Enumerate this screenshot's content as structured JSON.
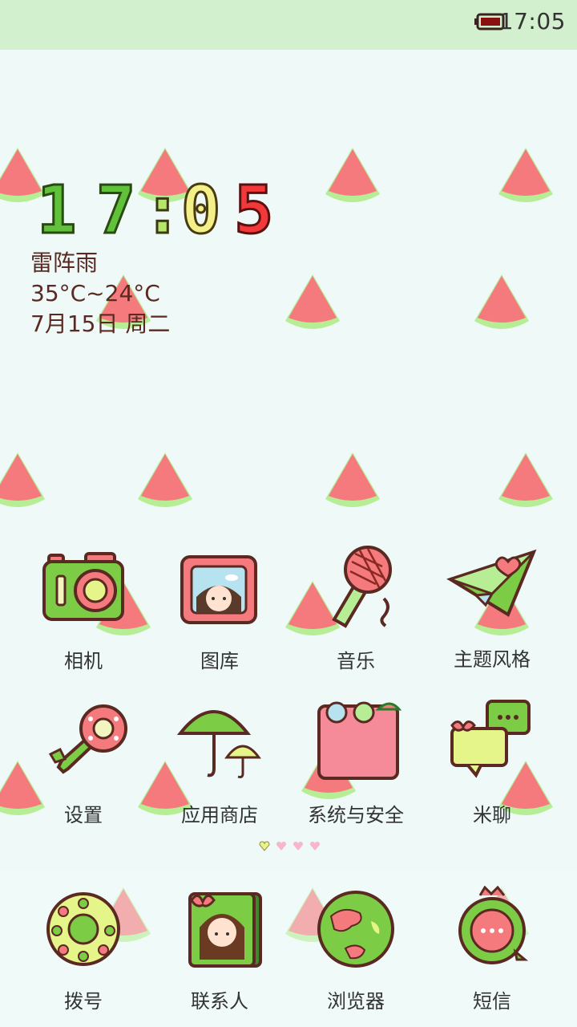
{
  "status_bar": {
    "time": "17:05",
    "battery_icon": "battery-icon"
  },
  "clock_widget": {
    "h1": "1",
    "h2": "7",
    "sep": ":",
    "m1": "0",
    "m2": "5"
  },
  "weather": {
    "condition": "雷阵雨",
    "temperature": "35°C~24°C",
    "date": "7月15日 周二"
  },
  "apps": [
    {
      "label": "相机",
      "icon": "camera-icon"
    },
    {
      "label": "图库",
      "icon": "gallery-icon"
    },
    {
      "label": "音乐",
      "icon": "music-icon"
    },
    {
      "label": "主题风格",
      "icon": "theme-icon"
    },
    {
      "label": "设置",
      "icon": "settings-icon"
    },
    {
      "label": "应用商店",
      "icon": "app-store-icon"
    },
    {
      "label": "系统与安全",
      "icon": "security-folder-icon"
    },
    {
      "label": "米聊",
      "icon": "mitalk-icon"
    }
  ],
  "page_indicator": {
    "pages": 4,
    "current": 1
  },
  "dock": [
    {
      "label": "拨号",
      "icon": "dialer-icon"
    },
    {
      "label": "联系人",
      "icon": "contacts-icon"
    },
    {
      "label": "浏览器",
      "icon": "browser-icon"
    },
    {
      "label": "短信",
      "icon": "messages-icon"
    }
  ],
  "colors": {
    "status_bar": "#d3f0ce",
    "background": "#eef9f8",
    "melon_red": "#f47a7d",
    "melon_green": "#b6ed95",
    "icon_green": "#7ccc45",
    "outline": "#5a2a22"
  }
}
